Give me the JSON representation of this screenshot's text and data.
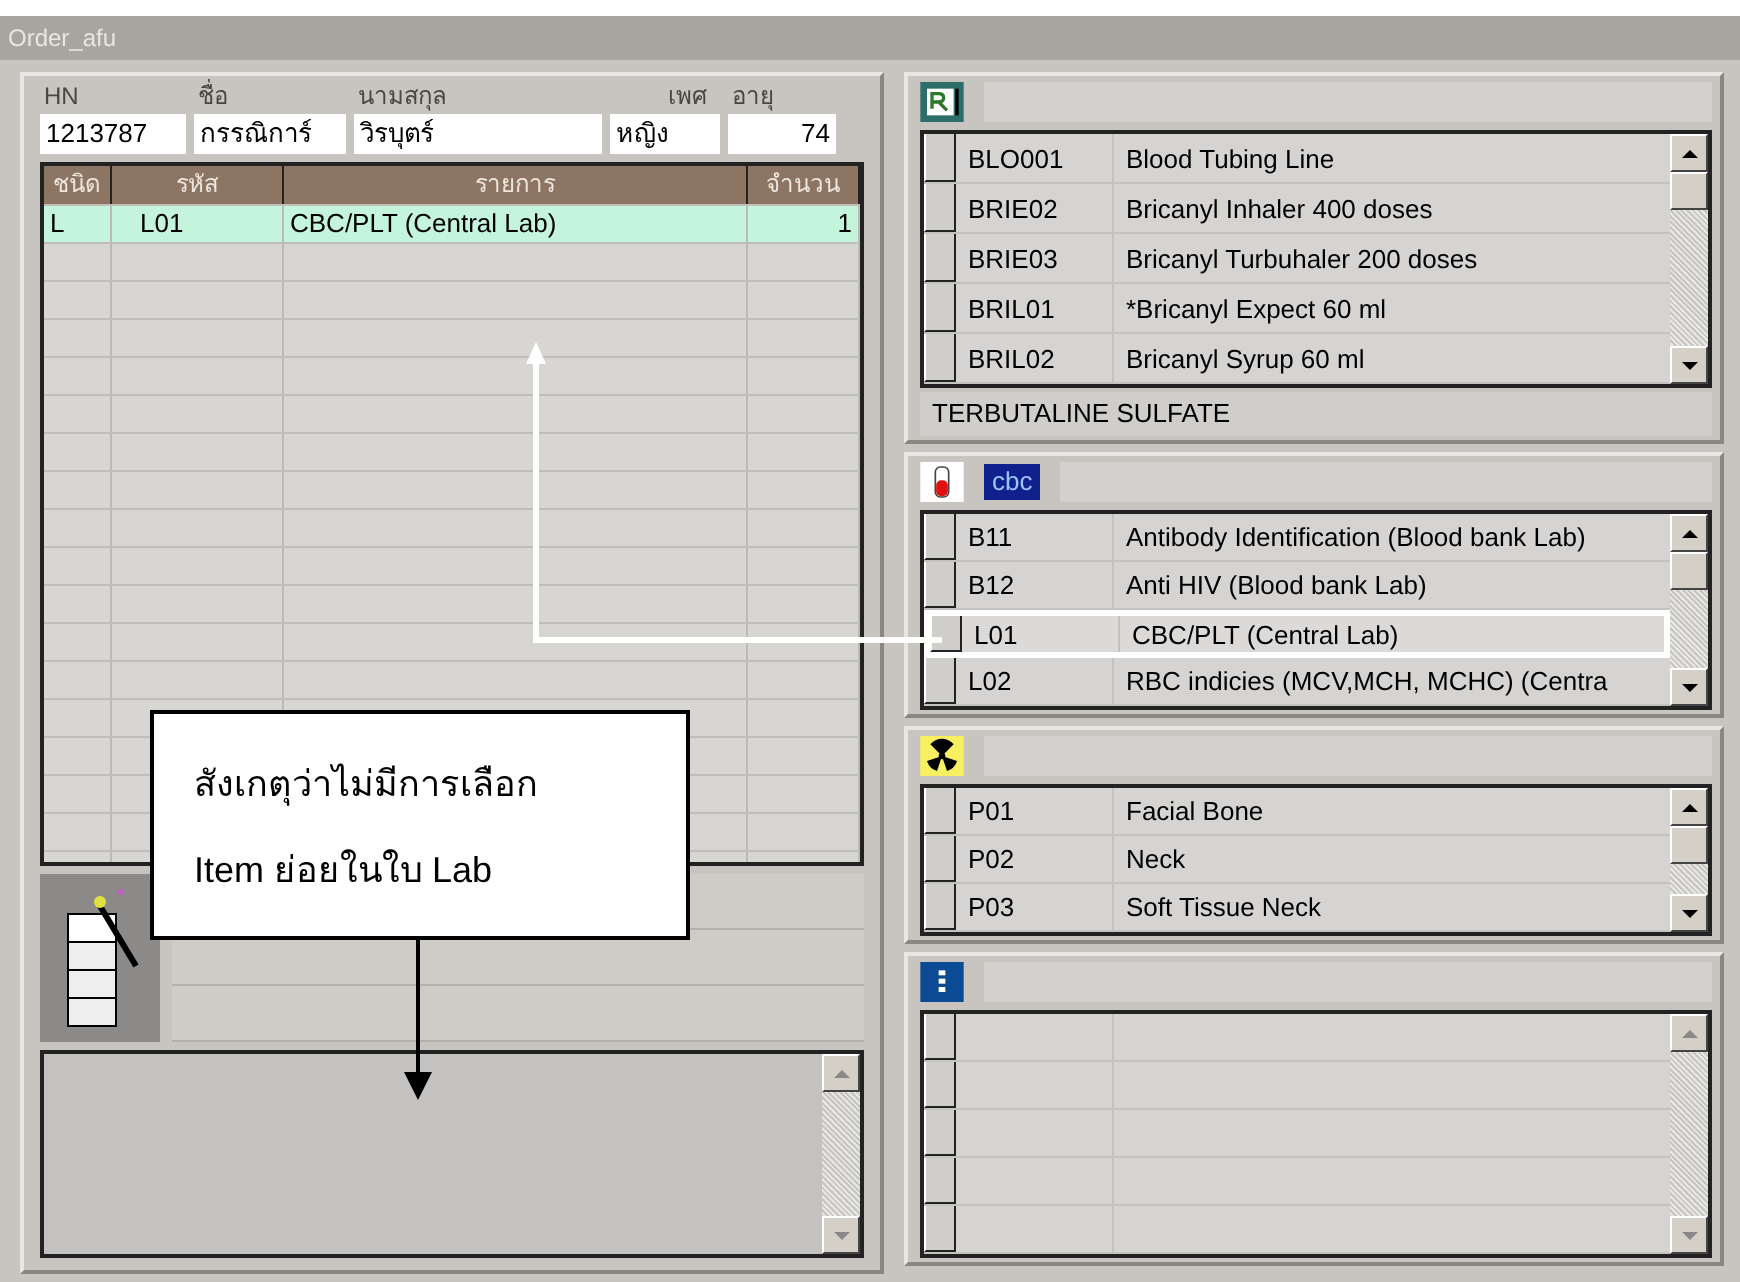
{
  "window": {
    "title": "Order_afu"
  },
  "patient": {
    "fields": [
      {
        "label": "HN",
        "value": "1213787"
      },
      {
        "label": "ชื่อ",
        "value": "กรรณิการ์"
      },
      {
        "label": "นามสกุล",
        "value": "วิรบุตร์"
      },
      {
        "label": "เพศ",
        "value": "หญิง"
      },
      {
        "label": "อายุ",
        "value": "74"
      }
    ]
  },
  "order_table": {
    "columns": [
      "ชนิด",
      "รหัส",
      "รายการ",
      "จำนวน"
    ],
    "rows": [
      {
        "cells": [
          "L",
          "L01",
          "CBC/PLT (Central Lab)",
          "1"
        ],
        "selected": true
      }
    ]
  },
  "panels": [
    {
      "kind": "drug",
      "rows": [
        {
          "code": "BLO001",
          "name": "Blood Tubing Line"
        },
        {
          "code": "BRIE02",
          "name": "Bricanyl Inhaler 400 doses"
        },
        {
          "code": "BRIE03",
          "name": "Bricanyl Turbuhaler 200 doses"
        },
        {
          "code": "BRIL01",
          "name": "*Bricanyl Expect 60 ml"
        },
        {
          "code": "BRIL02",
          "name": "Bricanyl Syrup 60 ml"
        }
      ],
      "footer": "TERBUTALINE SULFATE"
    },
    {
      "kind": "lab",
      "tag": "cbc",
      "rows": [
        {
          "code": "B11",
          "name": "Antibody Identification (Blood bank Lab)",
          "highlighted": false
        },
        {
          "code": "B12",
          "name": "Anti HIV (Blood bank Lab)",
          "highlighted": false
        },
        {
          "code": "L01",
          "name": "CBC/PLT (Central Lab)",
          "highlighted": true
        },
        {
          "code": "L02",
          "name": "RBC indicies (MCV,MCH, MCHC) (Centra",
          "highlighted": false
        }
      ]
    },
    {
      "kind": "xray",
      "rows": [
        {
          "code": "P01",
          "name": "Facial Bone"
        },
        {
          "code": "P02",
          "name": "Neck"
        },
        {
          "code": "P03",
          "name": "Soft Tissue Neck"
        }
      ]
    },
    {
      "kind": "info"
    }
  ],
  "callout": {
    "lines": [
      "สังเกตุว่าไม่มีการเลือก",
      "Item ย่อยในใบ Lab"
    ]
  }
}
